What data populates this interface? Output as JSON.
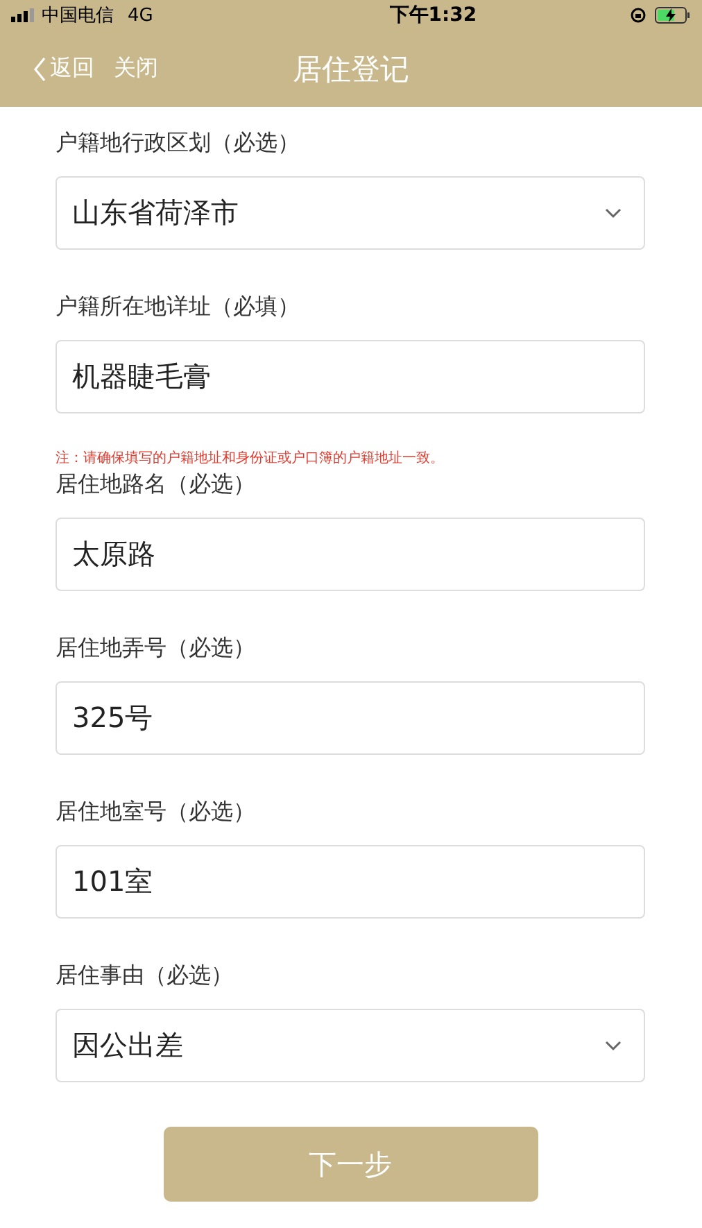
{
  "status_bar": {
    "carrier": "中国电信",
    "network": "4G",
    "time": "下午1:32"
  },
  "nav": {
    "back": "返回",
    "close": "关闭",
    "title": "居住登记"
  },
  "fields": [
    {
      "kind": "select",
      "label": "户籍地行政区划（必选）",
      "value": "山东省荷泽市"
    },
    {
      "kind": "input",
      "label": "户籍所在地详址（必填）",
      "value": "机器睫毛膏",
      "note": "注：请确保填写的户籍地址和身份证或户口簿的户籍地址一致。"
    },
    {
      "kind": "input",
      "label": "居住地路名（必选）",
      "value": "太原路"
    },
    {
      "kind": "input",
      "label": "居住地弄号（必选）",
      "value": "325号"
    },
    {
      "kind": "input",
      "label": "居住地室号（必选）",
      "value": "101室"
    },
    {
      "kind": "select",
      "label": "居住事由（必选）",
      "value": "因公出差"
    }
  ],
  "next_button": "下一步"
}
